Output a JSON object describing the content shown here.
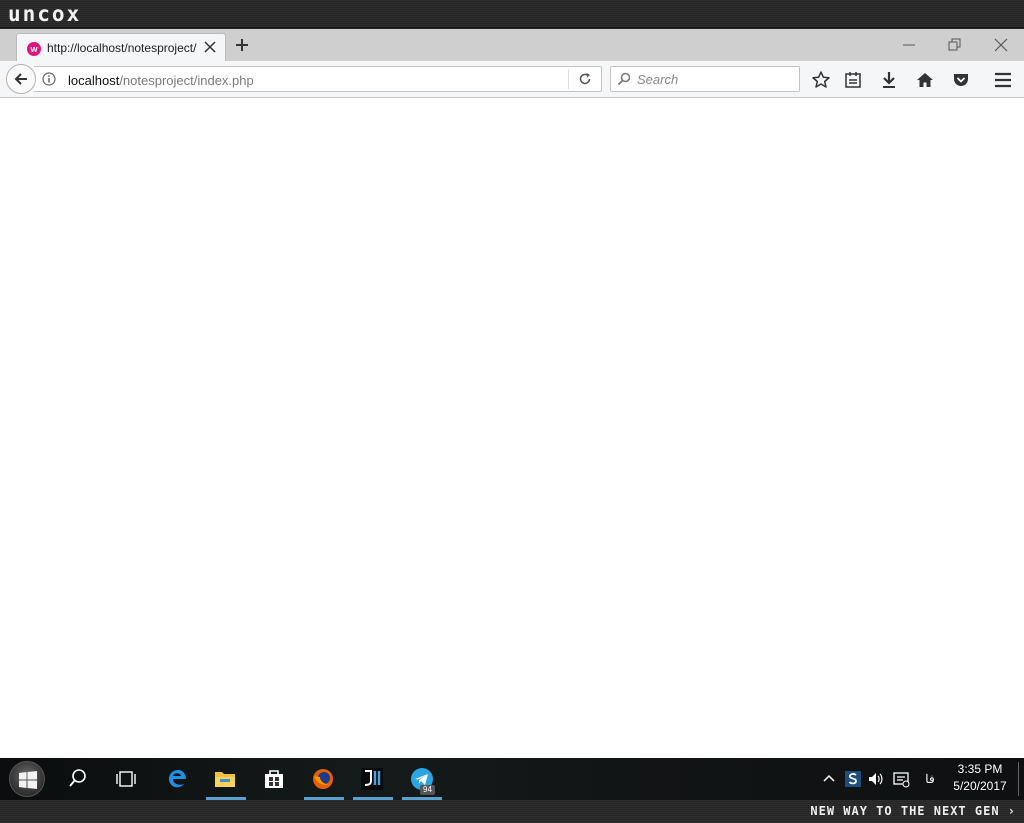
{
  "brand": {
    "logo_text": "uncox"
  },
  "browser": {
    "tab": {
      "title": "http://localhost/notesproject/index.php",
      "favicon": "wamp-favicon"
    },
    "address": {
      "host": "localhost",
      "path": "/notesproject/index.php"
    },
    "search": {
      "placeholder": "Search"
    },
    "toolbar_icons": [
      "bookmark-star-icon",
      "reading-list-icon",
      "downloads-icon",
      "home-icon",
      "pocket-icon",
      "menu-icon"
    ]
  },
  "taskbar": {
    "pinned": [
      "search-icon",
      "task-view-icon",
      "edge-icon",
      "file-explorer-icon",
      "store-icon",
      "firefox-icon",
      "jetbrains-icon",
      "telegram-icon"
    ],
    "telegram_badge": "94",
    "tray": {
      "language": "فا"
    },
    "clock": {
      "time": "3:35 PM",
      "date": "5/20/2017"
    }
  },
  "bottom_strip": {
    "tagline": "New way to the next gen ›"
  },
  "colors": {
    "accent_underline": "#5aa0d0",
    "favicon": "#e0147c"
  }
}
